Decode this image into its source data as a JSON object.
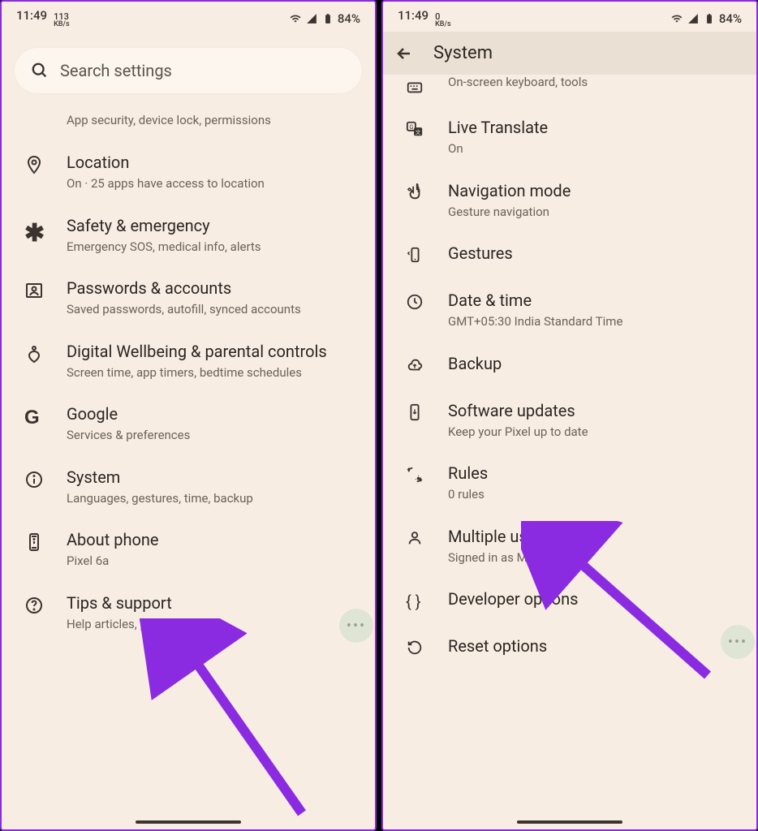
{
  "status": {
    "time": "11:49",
    "net_value": "113",
    "net_unit": "KB/s",
    "net_value2": "0",
    "battery": "84%"
  },
  "search": {
    "placeholder": "Search settings"
  },
  "left": {
    "truncated_sub": "App security, device lock, permissions",
    "items": [
      {
        "title": "Location",
        "sub": "On · 25 apps have access to location"
      },
      {
        "title": "Safety & emergency",
        "sub": "Emergency SOS, medical info, alerts"
      },
      {
        "title": "Passwords & accounts",
        "sub": "Saved passwords, autofill, synced accounts"
      },
      {
        "title": "Digital Wellbeing & parental controls",
        "sub": "Screen time, app timers, bedtime schedules"
      },
      {
        "title": "Google",
        "sub": "Services & preferences"
      },
      {
        "title": "System",
        "sub": "Languages, gestures, time, backup"
      },
      {
        "title": "About phone",
        "sub": "Pixel 6a"
      },
      {
        "title": "Tips & support",
        "sub": "Help articles, phone & chat"
      }
    ]
  },
  "right": {
    "header": "System",
    "partial_sub": "On-screen keyboard, tools",
    "items": [
      {
        "title": "Live Translate",
        "sub": "On"
      },
      {
        "title": "Navigation mode",
        "sub": "Gesture navigation"
      },
      {
        "title": "Gestures",
        "sub": ""
      },
      {
        "title": "Date & time",
        "sub": "GMT+05:30 India Standard Time"
      },
      {
        "title": "Backup",
        "sub": ""
      },
      {
        "title": "Software updates",
        "sub": "Keep your Pixel up to date"
      },
      {
        "title": "Rules",
        "sub": "0 rules"
      },
      {
        "title": "Multiple users",
        "sub": "Signed in as Mehvish"
      },
      {
        "title": "Developer options",
        "sub": ""
      },
      {
        "title": "Reset options",
        "sub": ""
      }
    ]
  },
  "fab": "•••"
}
